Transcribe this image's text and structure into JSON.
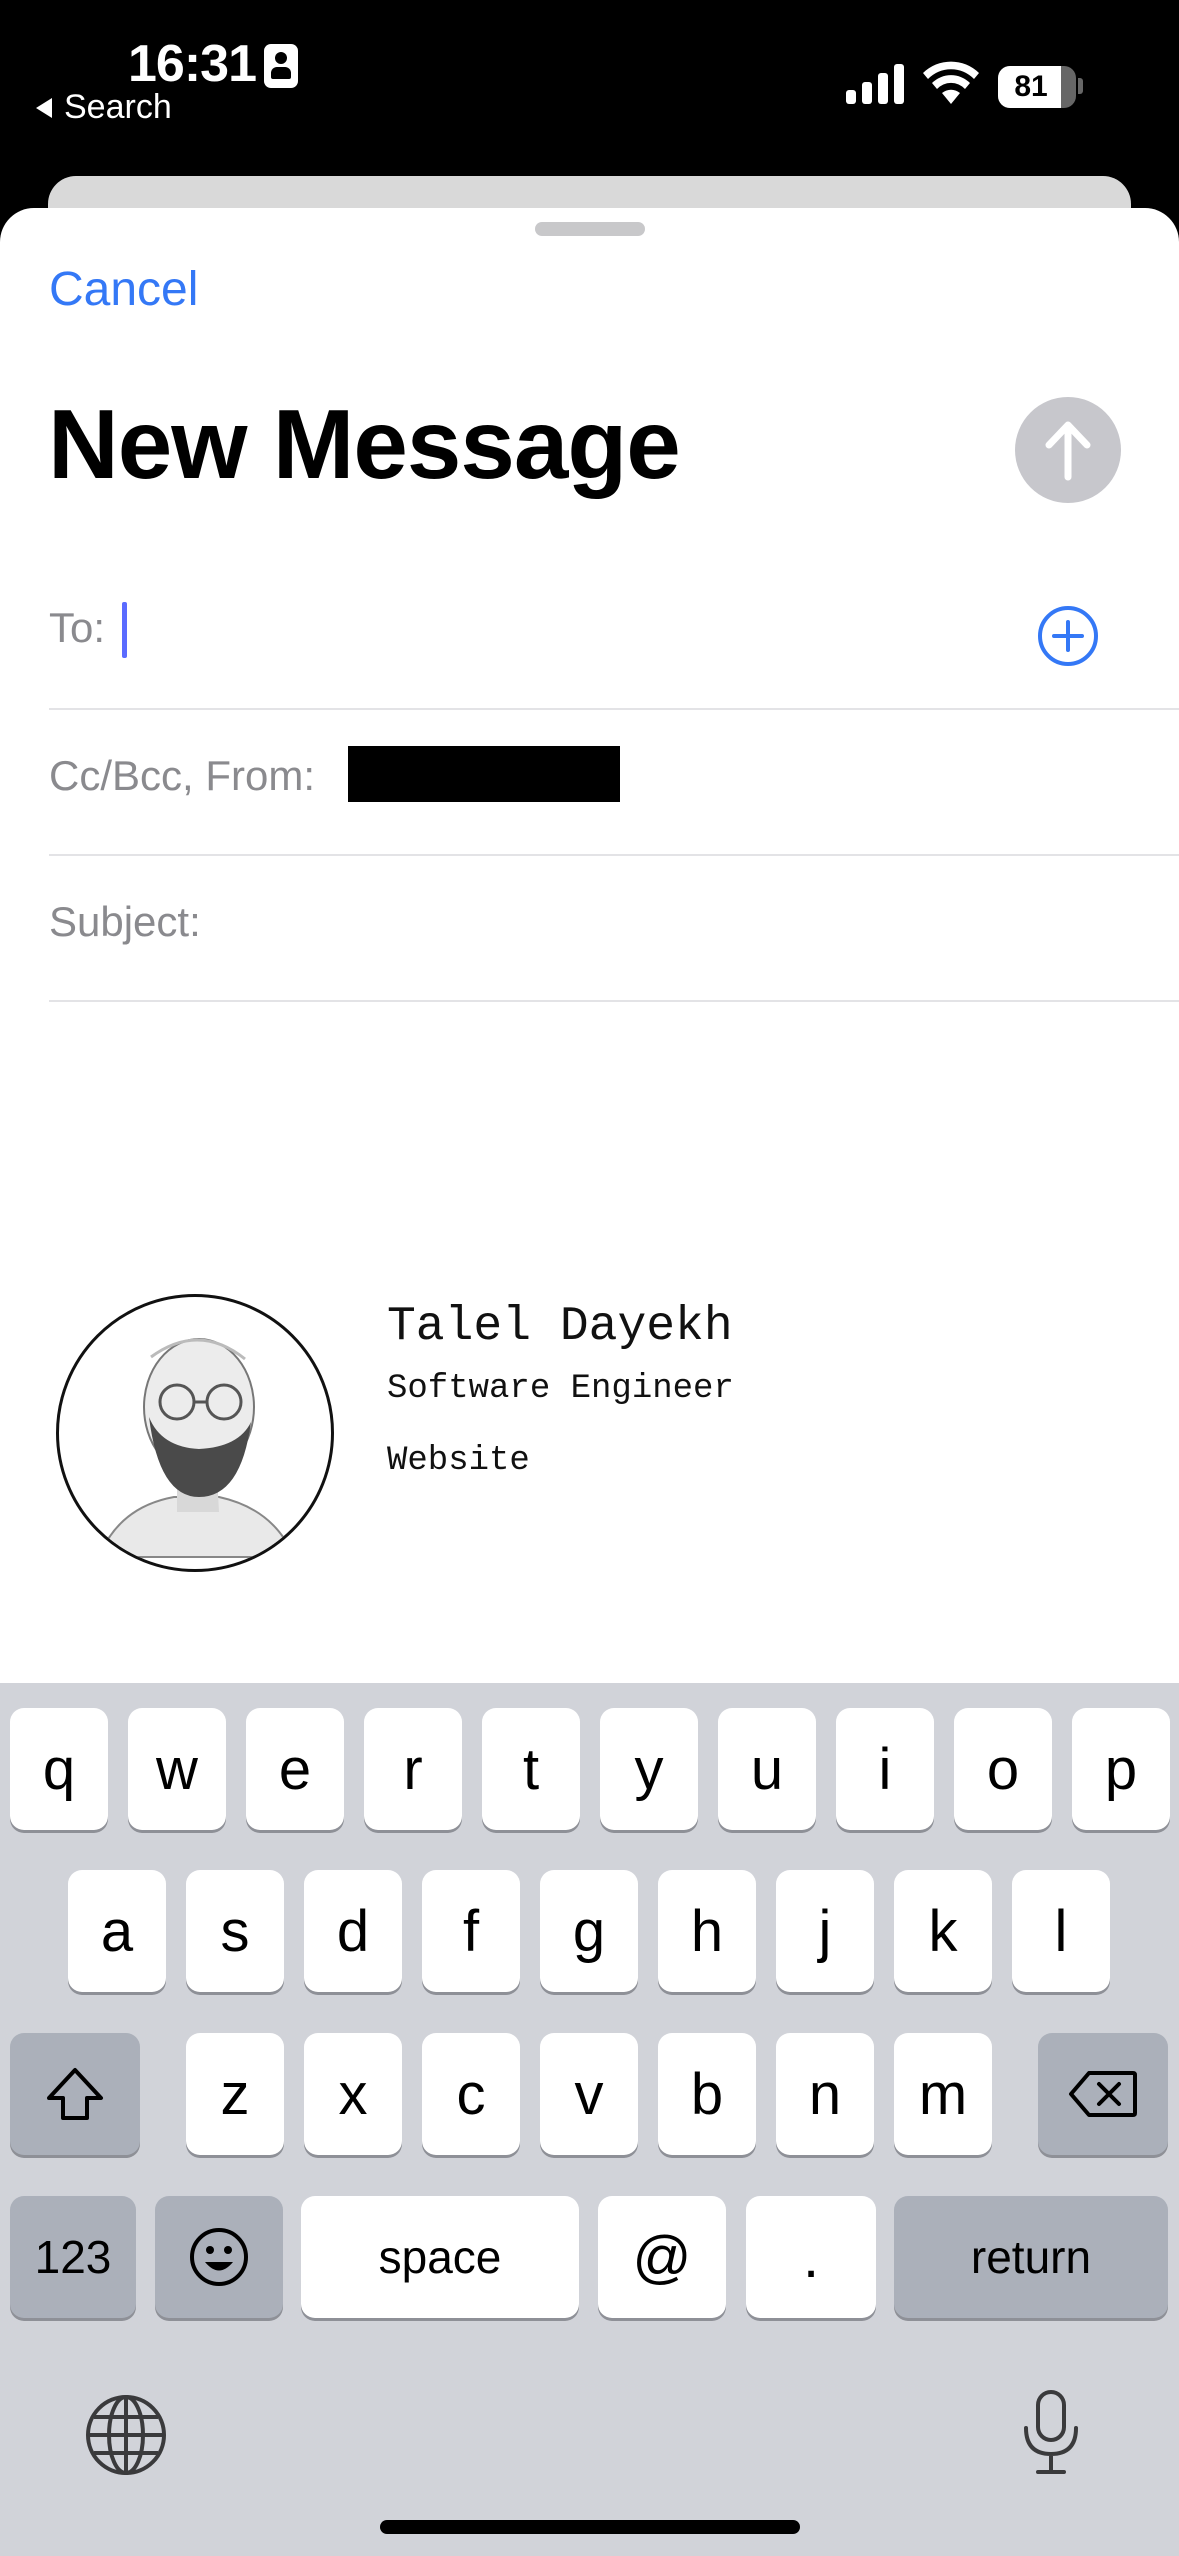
{
  "status_bar": {
    "time": "16:31",
    "back_label": "Search",
    "battery_percent": "81",
    "battery_level": 0.81
  },
  "compose": {
    "cancel_label": "Cancel",
    "title": "New Message",
    "to_label": "To:",
    "cc_label": "Cc/Bcc, From:",
    "subject_label": "Subject:"
  },
  "signature": {
    "name": "Talel Dayekh",
    "role": "Software Engineer",
    "website": "Website"
  },
  "keyboard": {
    "row1": [
      "q",
      "w",
      "e",
      "r",
      "t",
      "y",
      "u",
      "i",
      "o",
      "p"
    ],
    "row2": [
      "a",
      "s",
      "d",
      "f",
      "g",
      "h",
      "j",
      "k",
      "l"
    ],
    "row3": [
      "z",
      "x",
      "c",
      "v",
      "b",
      "n",
      "m"
    ],
    "numbers_label": "123",
    "space_label": "space",
    "at_label": "@",
    "period_label": ".",
    "return_label": "return"
  },
  "colors": {
    "accent": "#3478f6",
    "caret": "#5a6bff",
    "keyboard_bg": "#d1d3d9"
  }
}
